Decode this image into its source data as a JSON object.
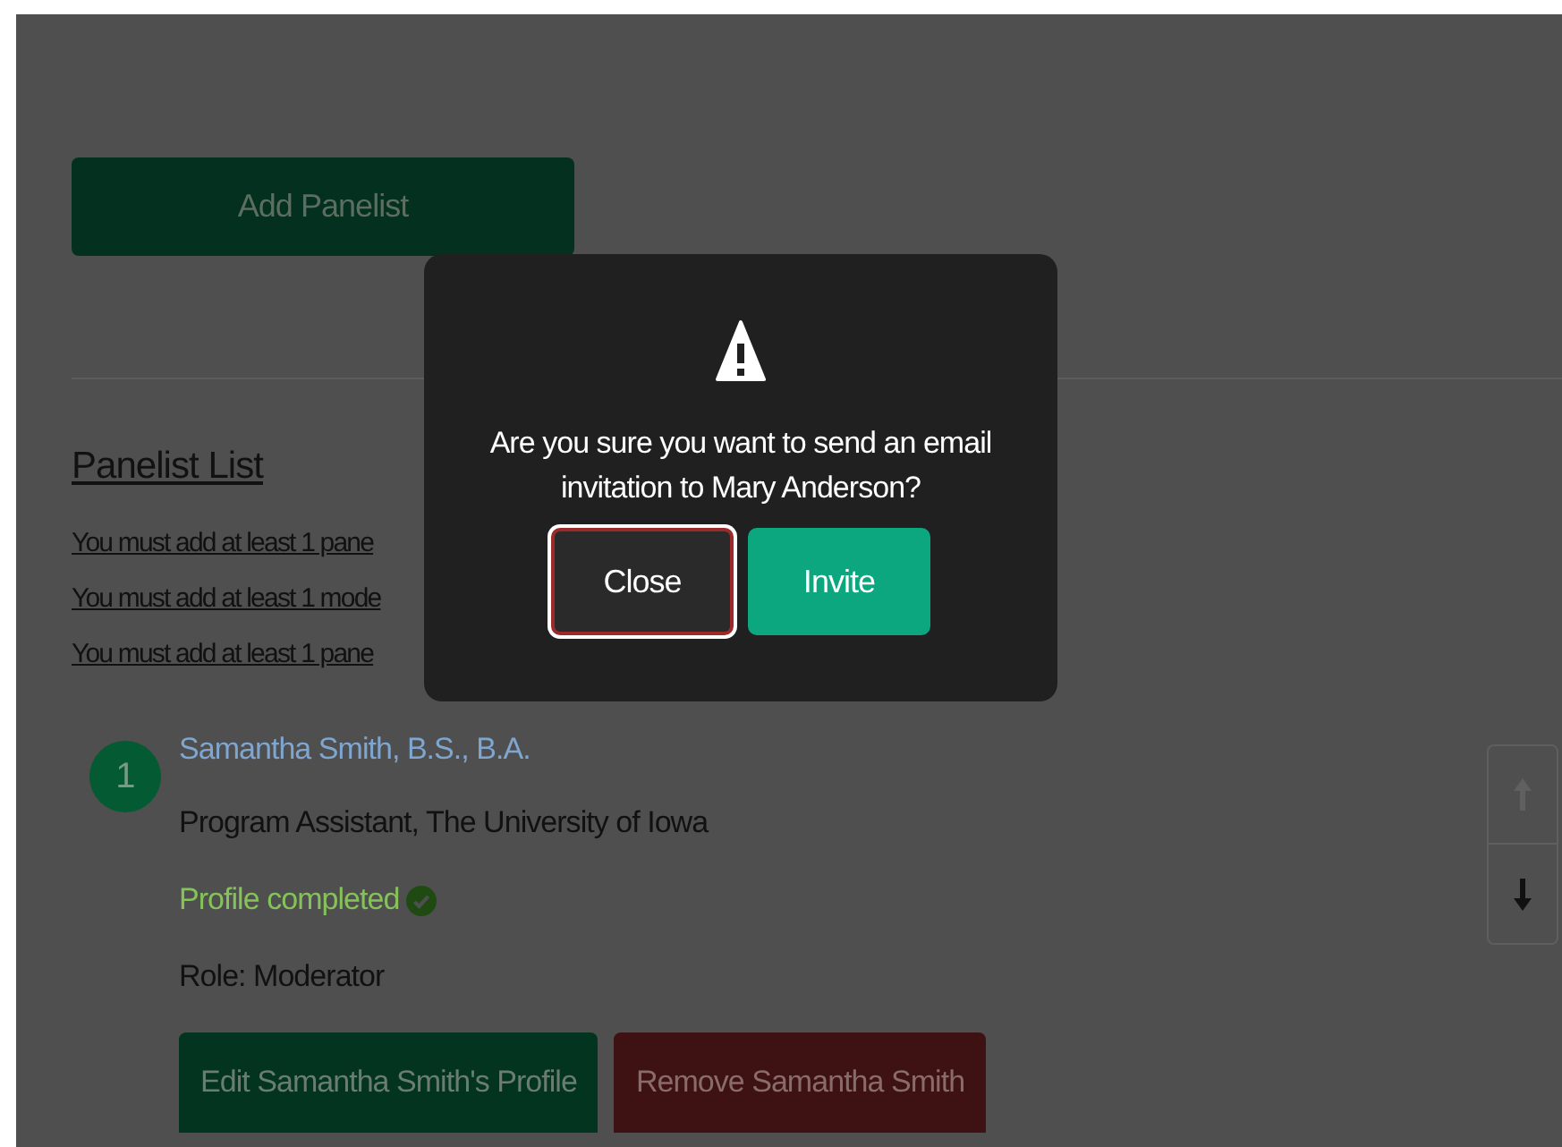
{
  "page": {
    "add_button": "Add Panelist",
    "list_heading": "Panelist List",
    "warnings": [
      "You must add at least 1 pane",
      "You must add at least 1 mode",
      "You must add at least 1 pane"
    ],
    "panelists": [
      {
        "number": "1",
        "name": "Samantha Smith, B.S., B.A.",
        "title": "Program Assistant, The University of Iowa",
        "status": "Profile completed",
        "completed": true,
        "role": "Role: Moderator",
        "edit_button": "Edit Samantha Smith's Profile",
        "remove_button": "Remove Samantha Smith",
        "can_move_up": false,
        "can_move_down": true
      }
    ]
  },
  "modal": {
    "message": "Are you sure you want to send an email invitation to Mary Anderson?",
    "buttons": [
      {
        "label": "Close",
        "kind": "secondary",
        "focused": true
      },
      {
        "label": "Invite",
        "kind": "primary",
        "focused": false
      }
    ]
  }
}
